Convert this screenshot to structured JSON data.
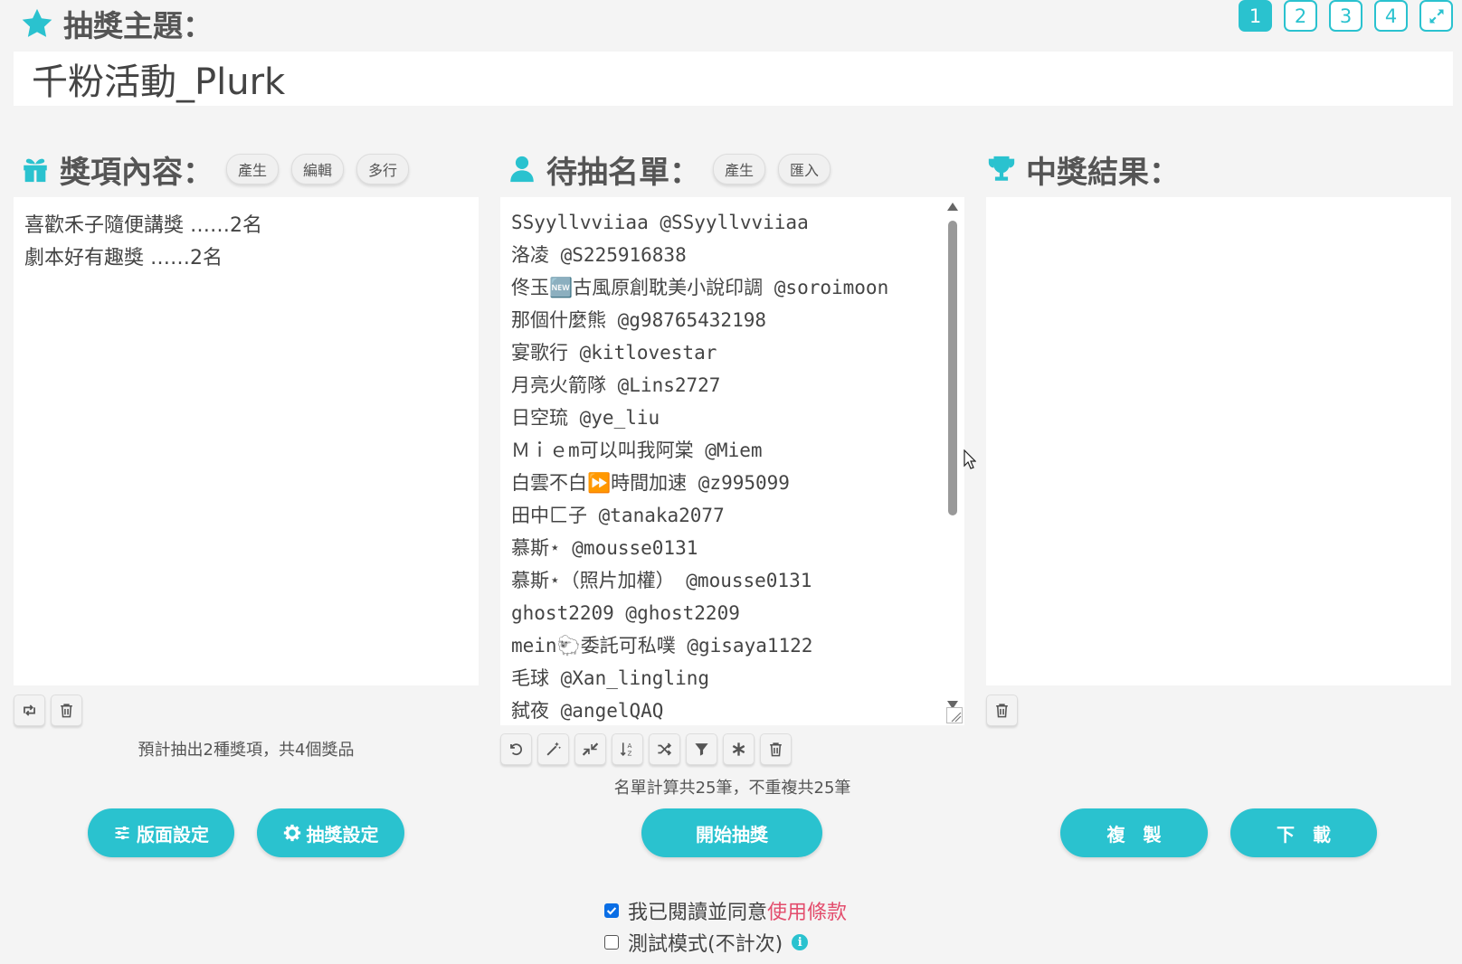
{
  "header": {
    "topic_label": "抽獎主題：",
    "topic_value": "千粉活動_Plurk",
    "pages": [
      "1",
      "2",
      "3",
      "4"
    ],
    "active_page": "1"
  },
  "prizes": {
    "title": "獎項內容：",
    "buttons": [
      "產生",
      "編輯",
      "多行"
    ],
    "items": [
      "喜歡禾子隨便講獎 ……2名",
      "劇本好有趣獎 ……2名"
    ],
    "summary": "預計抽出2種獎項，共4個獎品"
  },
  "candidates": {
    "title": "待抽名單：",
    "buttons": [
      "產生",
      "匯入"
    ],
    "rows": [
      "SSyyllvviiaa @SSyyllvviiaa",
      "洛凌 @S225916838",
      "佟玉🆕古風原創耽美小說印調 @soroimoon",
      "那個什麼熊 @g98765432198",
      "宴歌行 @kitlovestar",
      "月亮火箭隊 @Lins2727",
      "日空琉 @ye_liu",
      "Ｍｉｅm可以叫我阿棠 @Miem",
      "白雲不白⏩時間加速 @z995099",
      "田中匚子 @tanaka2077",
      "慕斯⋆ @mousse0131",
      "慕斯⋆（照片加權） @mousse0131",
      "ghost2209 @ghost2209",
      "mein🐑委託可私噗 @gisaya1122",
      "毛球 @Xan_lingling",
      "弑夜 @angelQAQ"
    ],
    "summary": "名單計算共25筆，不重複共25筆"
  },
  "results": {
    "title": "中獎結果："
  },
  "actions": {
    "layout_settings": "版面設定",
    "draw_settings": "抽獎設定",
    "start_draw": "開始抽獎",
    "copy": "複　製",
    "download": "下　載"
  },
  "agreements": {
    "agree_prefix": "我已閱讀並同意",
    "terms_link": "使用條款",
    "test_mode": "測試模式(不計次)"
  },
  "colors": {
    "accent": "#2ac2cf",
    "link": "#e34d6d",
    "checkbox": "#0a6ee5"
  }
}
